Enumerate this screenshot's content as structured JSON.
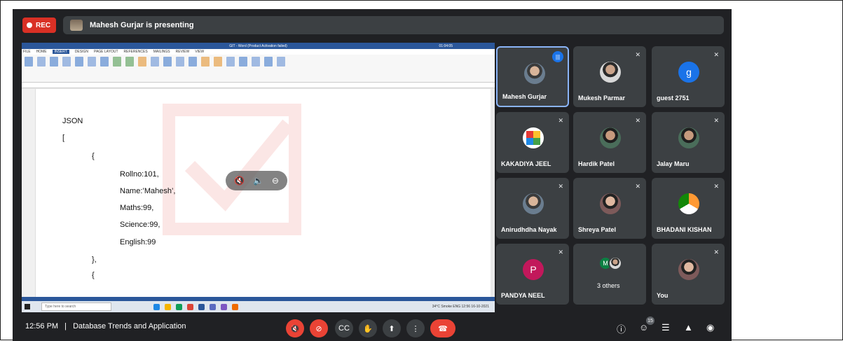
{
  "top_bar": {
    "rec_label": "REC",
    "presenting_text": "Mahesh Gurjar is presenting"
  },
  "shared_screen": {
    "word_title": "GIT - Word (Product Activation failed)",
    "tabs": [
      "FILE",
      "HOME",
      "INSERT",
      "DESIGN",
      "PAGE LAYOUT",
      "REFERENCES",
      "MAILINGS",
      "REVIEW",
      "VIEW"
    ],
    "active_tab": "INSERT",
    "timer": "01:04:05",
    "doc_lines": {
      "heading": "JSON",
      "open_bracket": "[",
      "open_brace": "{",
      "rollno": "Rollno:101,",
      "name": "Name:’Mahesh’,",
      "maths": "Maths:99,",
      "science": "Science:99,",
      "english": "English:99",
      "close_brace": "},",
      "next_brace": "{"
    },
    "taskbar_search": "Type here to search",
    "taskbar_tray": "34°C Smoke  ENG 12:56 16-10-2021"
  },
  "participants": [
    {
      "name": "Mahesh Gurjar",
      "speaking": true
    },
    {
      "name": "Mukesh Parmar",
      "speaking": false
    },
    {
      "name": "guest 2751",
      "initial": "g",
      "color": "#1a73e8",
      "speaking": false
    },
    {
      "name": "KAKADIYA JEEL",
      "speaking": false
    },
    {
      "name": "Hardik Patel",
      "speaking": false
    },
    {
      "name": "Jalay Maru",
      "speaking": false
    },
    {
      "name": "Anirudhdha Nayak",
      "speaking": false
    },
    {
      "name": "Shreya Patel",
      "speaking": false
    },
    {
      "name": "BHADANI KISHAN",
      "speaking": false
    },
    {
      "name": "PANDYA NEEL",
      "initial": "P",
      "color": "#c2185b",
      "speaking": false
    },
    {
      "name": "3 others",
      "stack_initial": "M",
      "speaking": false
    },
    {
      "name": "You",
      "speaking": false
    }
  ],
  "bottom_bar": {
    "time": "12:56 PM",
    "separator": "|",
    "meeting_name": "Database Trends and Application",
    "people_count": "15"
  },
  "colors": {
    "background": "#202124",
    "tile": "#3c4043",
    "danger": "#ea4335",
    "accent": "#8ab4f8"
  }
}
